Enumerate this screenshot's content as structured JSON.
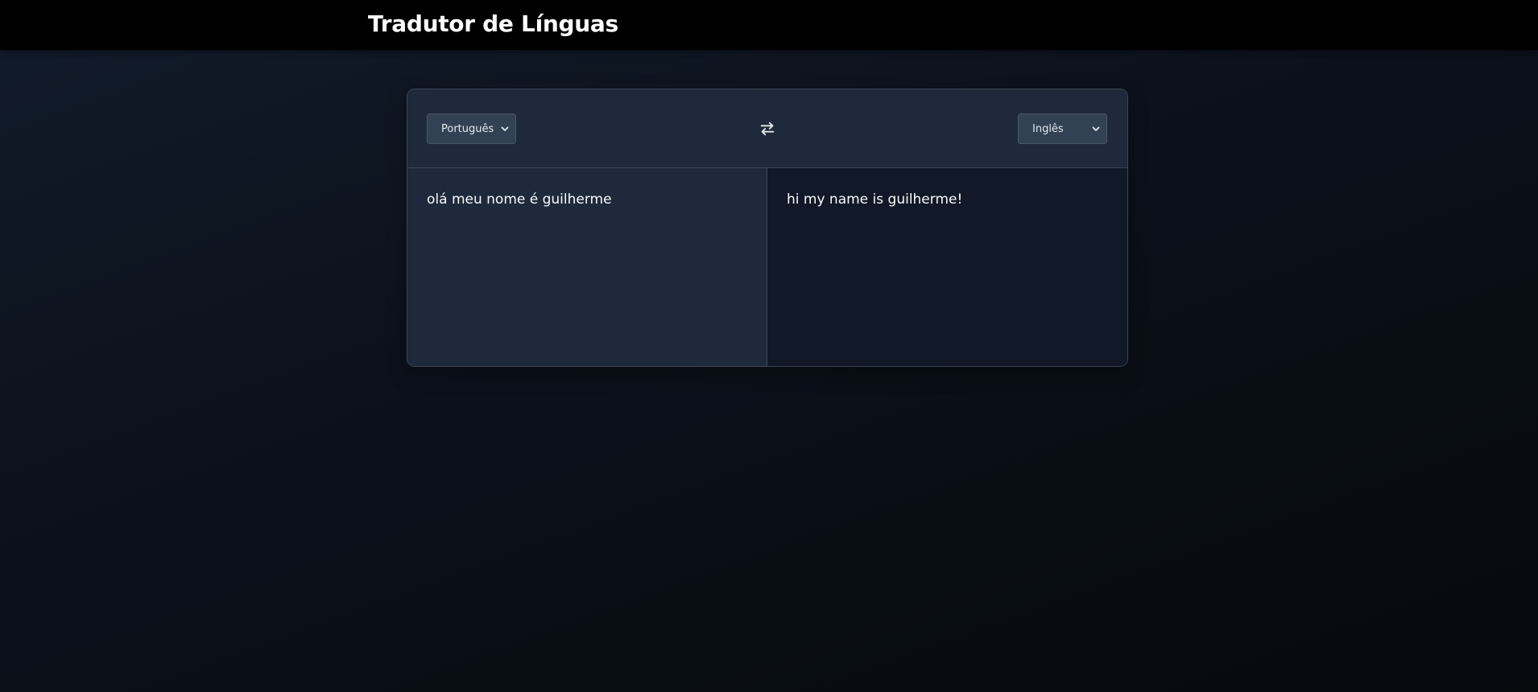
{
  "header": {
    "title": "Tradutor de Línguas"
  },
  "translator": {
    "source_language": "Português",
    "target_language": "Inglês",
    "source_text": "olá meu nome é guilherme",
    "translated_text": "hi my name is guilherme!",
    "swap_icon": "swap-arrows-icon"
  }
}
